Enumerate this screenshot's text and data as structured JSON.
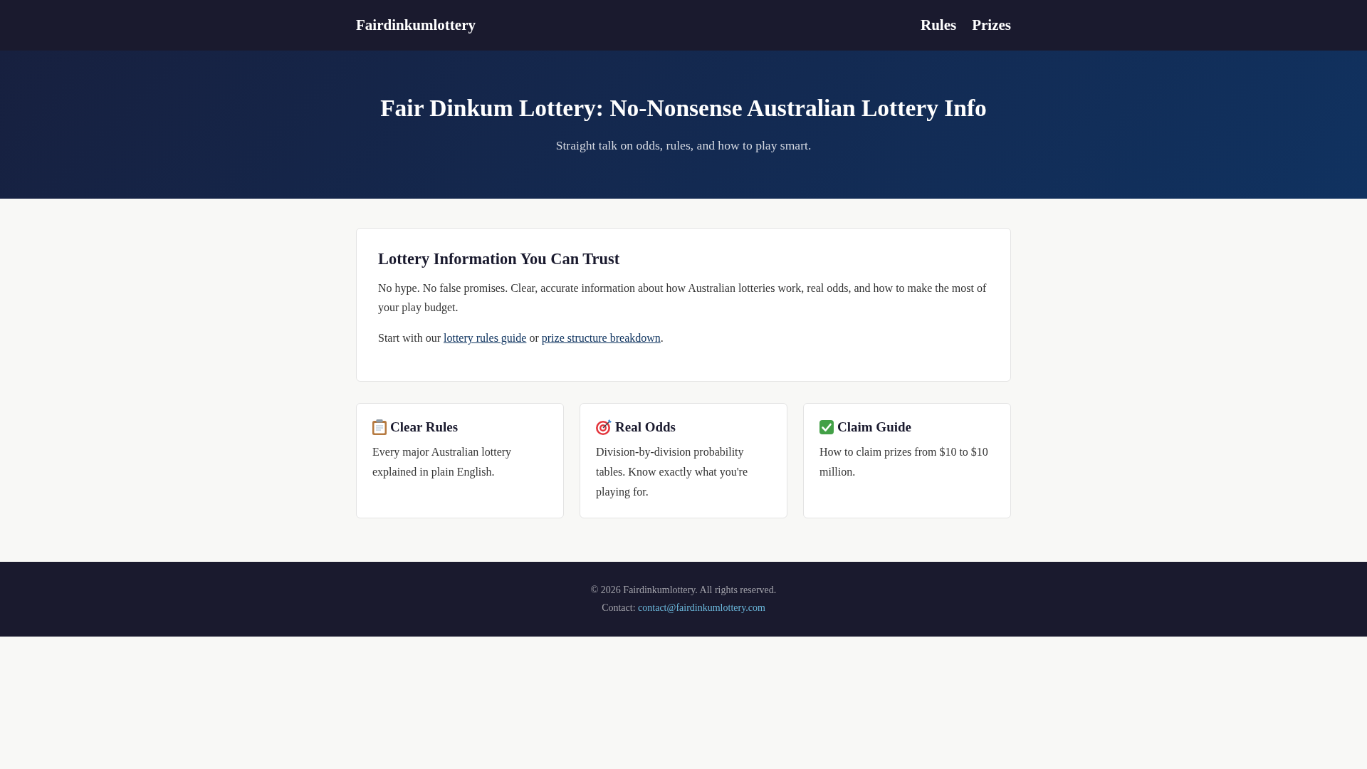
{
  "header": {
    "logo": "Fairdinkumlottery",
    "nav": [
      {
        "label": "Rules"
      },
      {
        "label": "Prizes"
      }
    ]
  },
  "hero": {
    "title": "Fair Dinkum Lottery: No-Nonsense Australian Lottery Info",
    "subtitle": "Straight talk on odds, rules, and how to play smart."
  },
  "intro": {
    "heading": "Lottery Information You Can Trust",
    "paragraphs": [
      {
        "segments": [
          {
            "kind": "text",
            "text": "No hype. No false promises. Clear, accurate information about how Australian lotteries work, real odds, and how to make the most of your play budget."
          }
        ]
      },
      {
        "segments": [
          {
            "kind": "text",
            "text": "Start with our "
          },
          {
            "kind": "link",
            "text": "lottery rules guide"
          },
          {
            "kind": "text",
            "text": " or "
          },
          {
            "kind": "link",
            "text": "prize structure breakdown"
          },
          {
            "kind": "text",
            "text": "."
          }
        ]
      }
    ]
  },
  "features": [
    {
      "kind": "clipboard",
      "title": "Clear Rules",
      "text": "Every major Australian lottery explained in plain English."
    },
    {
      "kind": "target",
      "title": "Real Odds",
      "text": "Division-by-division probability tables. Know exactly what you're playing for."
    },
    {
      "kind": "check",
      "title": "Claim Guide",
      "text": "How to claim prizes from $10 to $10 million."
    }
  ],
  "footer": {
    "copyright": "© 2026 Fairdinkumlottery. All rights reserved.",
    "contact": [
      {
        "kind": "text",
        "text": "Contact: "
      },
      {
        "kind": "link",
        "text": "contact@fairdinkumlottery.com"
      }
    ]
  }
}
